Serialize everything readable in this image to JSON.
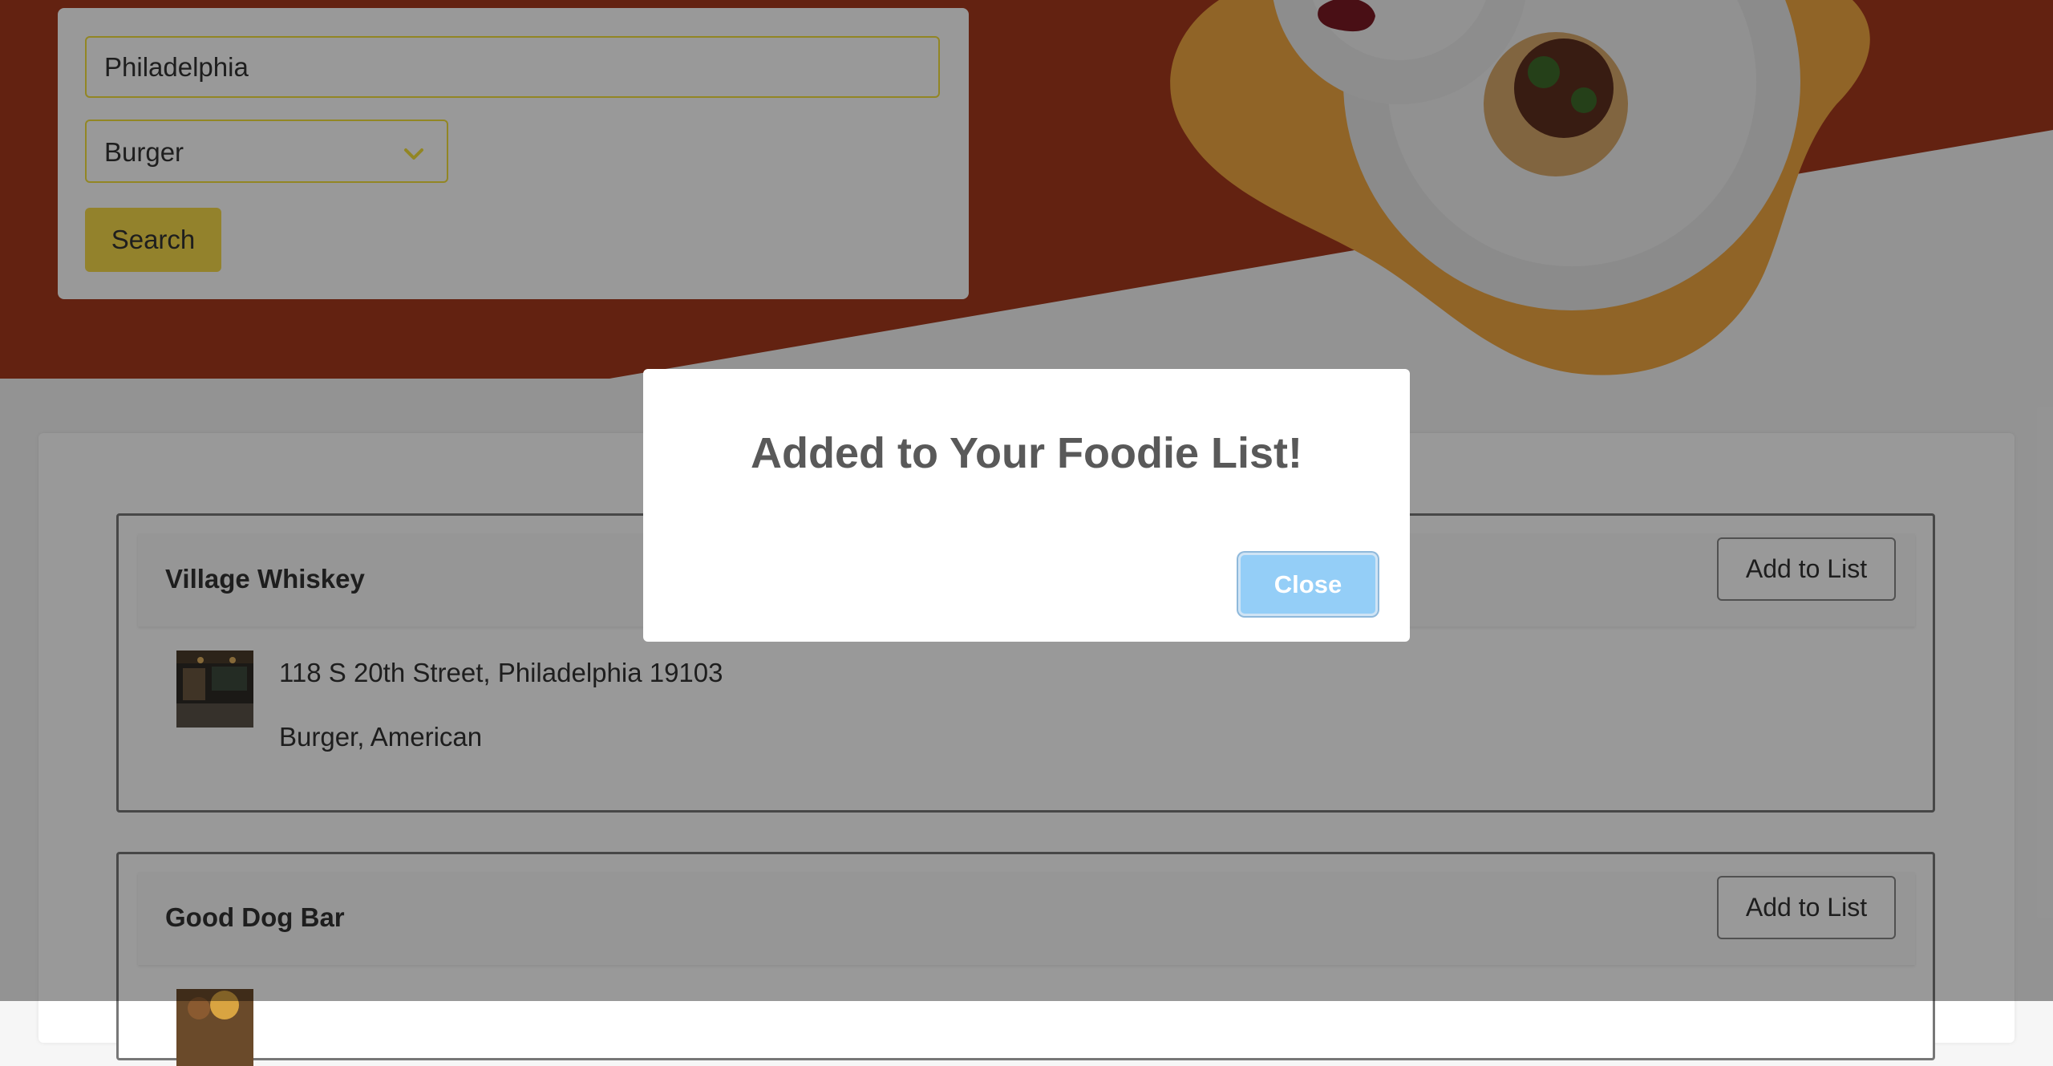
{
  "search": {
    "city_value": "Philadelphia",
    "cuisine_selected": "Burger",
    "search_label": "Search"
  },
  "results": [
    {
      "name": "Village Whiskey",
      "add_label": "Add to List",
      "address": "118 S 20th Street, Philadelphia 19103",
      "categories": "Burger, American"
    },
    {
      "name": "Good Dog Bar",
      "add_label": "Add to List"
    }
  ],
  "modal": {
    "title": "Added to Your Foodie List!",
    "close_label": "Close"
  },
  "colors": {
    "hero": "#a53a1d",
    "accent": "#f5d94a",
    "close_button": "#94cef7"
  }
}
